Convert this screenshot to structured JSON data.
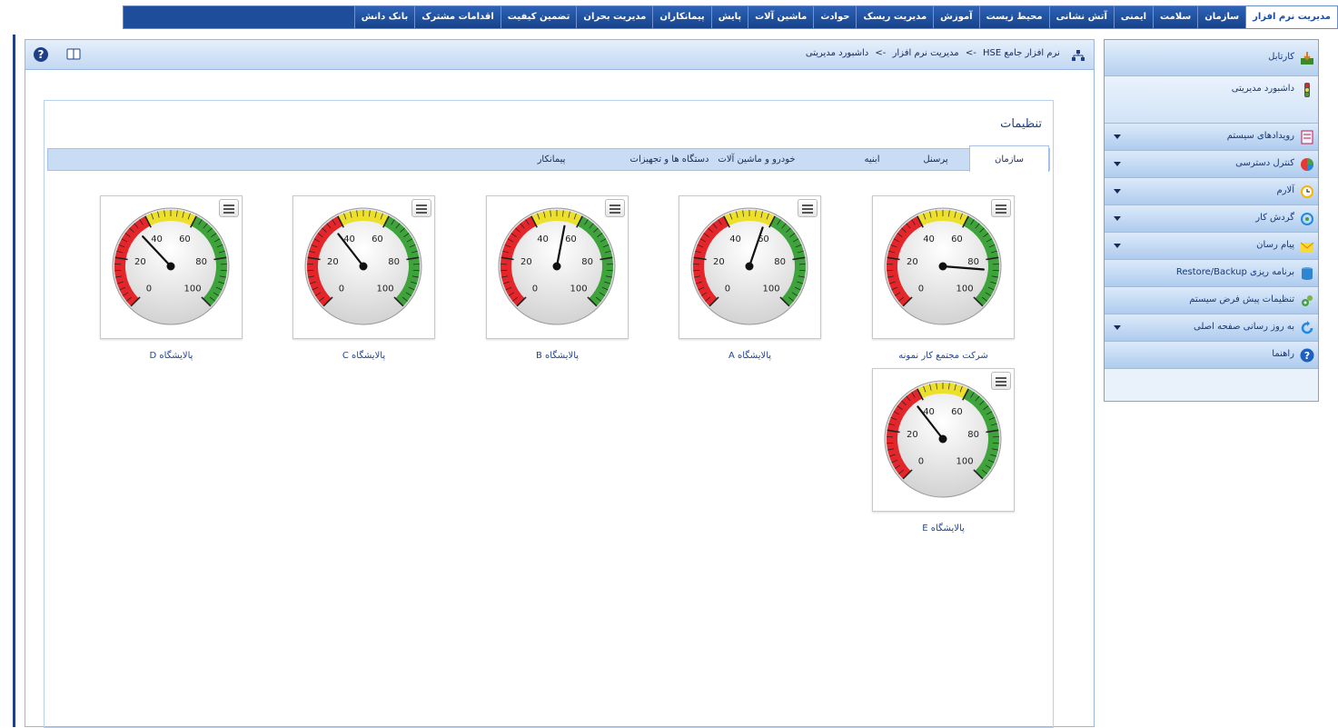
{
  "top_menu": [
    "مدیریت نرم افزار",
    "سازمان",
    "سلامت",
    "ایمنی",
    "آتش نشانی",
    "محیط زیست",
    "آموزش",
    "مدیریت ریسک",
    "حوادث",
    "ماشین آلات",
    "پایش",
    "پیمانکاران",
    "مدیریت بحران",
    "تضمین کیفیت",
    "اقدامات مشترک",
    "بانک دانش"
  ],
  "breadcrumb": {
    "root": "نرم افزار جامع HSE",
    "sep": "->",
    "section": "مدیریت نرم افزار",
    "page": "داشبورد مدیریتی"
  },
  "panel": {
    "title": "تنظیمات"
  },
  "tabs": [
    "سازمان",
    "پرسنل",
    "ابنیه",
    "خودرو و ماشین آلات",
    "دستگاه ها و تجهیزات",
    "پیمانکار"
  ],
  "sidebar": [
    {
      "label": "کارتابل",
      "icon": "inbox-icon",
      "caret": false
    },
    {
      "label": "داشبورد مدیریتی",
      "icon": "traffic-light-icon",
      "caret": false
    },
    {
      "label": "رویدادهای سیستم",
      "icon": "event-log-icon",
      "caret": true
    },
    {
      "label": "کنترل دسترسی",
      "icon": "access-control-icon",
      "caret": true
    },
    {
      "label": "آلارم",
      "icon": "clock-icon",
      "caret": true
    },
    {
      "label": "گردش کار",
      "icon": "workflow-icon",
      "caret": true
    },
    {
      "label": "پیام رسان",
      "icon": "envelope-icon",
      "caret": true
    },
    {
      "label": "برنامه ریزی Restore/Backup",
      "icon": "database-icon",
      "caret": false
    },
    {
      "label": "تنظیمات پیش فرض سیستم",
      "icon": "gears-icon",
      "caret": false
    },
    {
      "label": "به روز رسانی صفحه اصلی",
      "icon": "refresh-icon",
      "caret": true
    },
    {
      "label": "راهنما",
      "icon": "help-icon",
      "caret": false
    }
  ],
  "gauge_ticks": [
    "0",
    "20",
    "40",
    "60",
    "80",
    "100"
  ],
  "gauge_colors": {
    "red": "#e4262b",
    "yellow": "#ece02d",
    "green": "#3ea33b"
  },
  "gauges": [
    {
      "label": "شرکت مجتمع کار نمونه",
      "value": 85
    },
    {
      "label": "پالایشگاه A",
      "value": 57
    },
    {
      "label": "پالایشگاه B",
      "value": 54
    },
    {
      "label": "پالایشگاه C",
      "value": 36
    },
    {
      "label": "پالایشگاه D",
      "value": 34
    },
    {
      "label": "پالایشگاه E",
      "value": 36
    }
  ]
}
